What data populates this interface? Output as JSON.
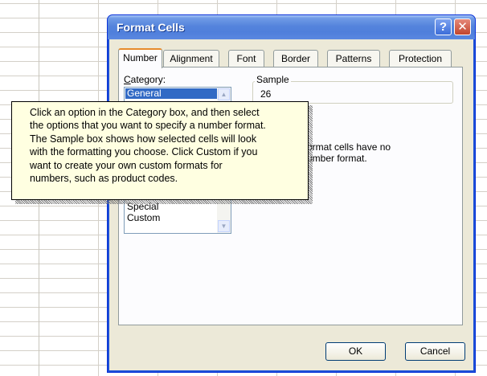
{
  "dialog": {
    "title": "Format Cells",
    "help_label": "?",
    "close_label": "✕",
    "tabs": [
      {
        "label": "Number",
        "active": true
      },
      {
        "label": "Alignment",
        "active": false
      },
      {
        "label": "Font",
        "active": false
      },
      {
        "label": "Border",
        "active": false
      },
      {
        "label": "Patterns",
        "active": false
      },
      {
        "label": "Protection",
        "active": false
      }
    ],
    "category_label": "Category:",
    "category_access_key": "C",
    "category_label_rest": "ategory:",
    "categories_visible": [
      "General",
      "Special",
      "Custom"
    ],
    "selected_category": "General",
    "sample_legend": "Sample",
    "sample_value": "26",
    "description_visible_lines": [
      "ormat cells have no",
      "umber format."
    ],
    "ok_label": "OK",
    "cancel_label": "Cancel"
  },
  "tooltip": {
    "lines": [
      "Click an option in the Category box, and then select",
      "the options that you want to specify a number format.",
      "The Sample box shows how selected cells will look",
      "with the formatting you choose. Click Custom if you",
      "want to create your own custom formats for",
      "numbers, such as product codes."
    ]
  },
  "colors": {
    "titlebar": "#4f7fdb",
    "dialog_bg": "#ece9d8",
    "tooltip_bg": "#ffffe1",
    "selection": "#316ac5"
  }
}
